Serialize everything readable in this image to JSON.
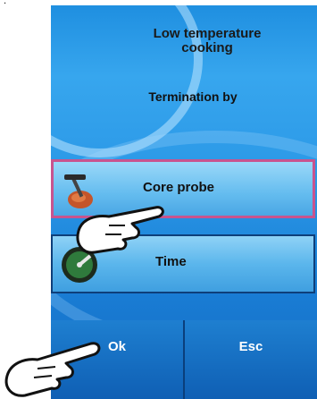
{
  "header": {
    "title_line1": "Low temperature",
    "title_line2": "cooking"
  },
  "subtitle": "Termination by",
  "options": [
    {
      "label": "Core probe",
      "icon": "core-probe-icon",
      "selected": true
    },
    {
      "label": "Time",
      "icon": "timer-icon",
      "selected": false
    }
  ],
  "buttons": {
    "ok": "Ok",
    "esc": "Esc"
  },
  "colors": {
    "screen": "#2a97e6",
    "selected_border": "#c8548e",
    "button_bar": "#1469c2"
  }
}
